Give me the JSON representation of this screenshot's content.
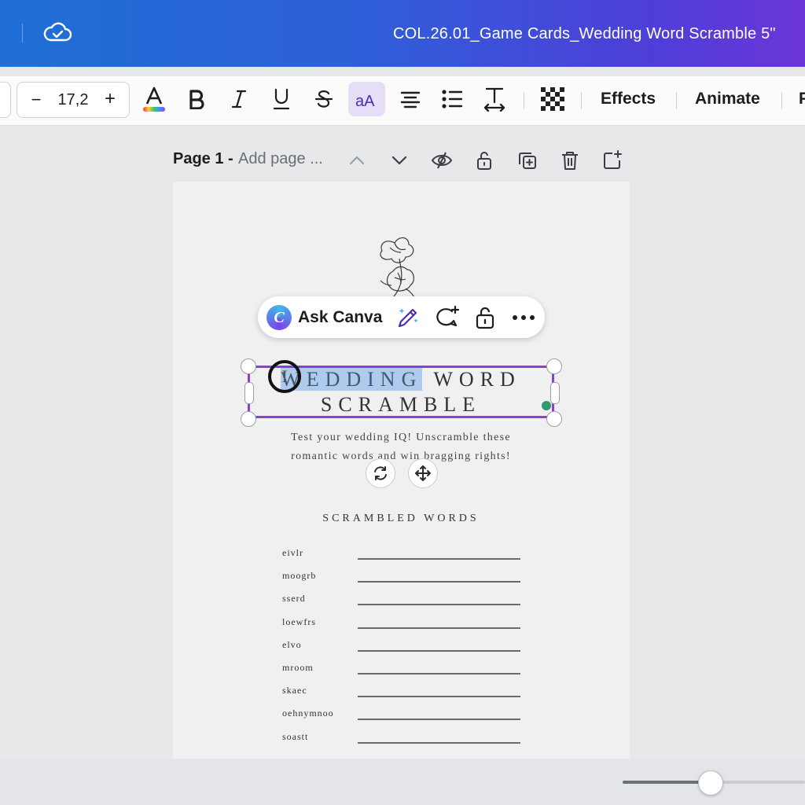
{
  "header": {
    "document_title": "COL.26.01_Game Cards_Wedding Word Scramble 5\"",
    "cloud_icon": "cloud-check-icon"
  },
  "toolbar": {
    "font_size": "17,2",
    "minus": "−",
    "plus": "+",
    "effects": "Effects",
    "animate": "Animate",
    "truncated_next": "P",
    "icons": [
      "text-color-icon",
      "bold-icon",
      "italic-icon",
      "underline-icon",
      "strikethrough-icon",
      "letter-case-icon",
      "align-center-icon",
      "list-icon",
      "spacing-icon",
      "transparency-icon"
    ],
    "text_color_accent": "#8b3fd9"
  },
  "page_header": {
    "label": "Page 1 -",
    "add_title_placeholder": "Add page ..."
  },
  "ask_bar": {
    "logo_letter": "C",
    "label": "Ask Canva"
  },
  "design": {
    "title_highlighted": "WEDDING",
    "title_rest_line1": " WORD",
    "title_line2": "SCRAMBLE",
    "subtitle_line1": "Test your wedding IQ! Unscramble these",
    "subtitle_line2": "romantic words and win bragging rights!",
    "section_heading": "SCRAMBLED WORDS",
    "words": [
      "eivlr",
      "moogrb",
      "sserd",
      "loewfrs",
      "elvo",
      "mroom",
      "skaec",
      "oehnymnoo",
      "soastt"
    ]
  },
  "zoom": {
    "level_fraction": 0.48
  },
  "colors": {
    "selection": "#8b3fd9",
    "highlight": "#aecbee",
    "rotate_dot": "#2e9a6e"
  }
}
